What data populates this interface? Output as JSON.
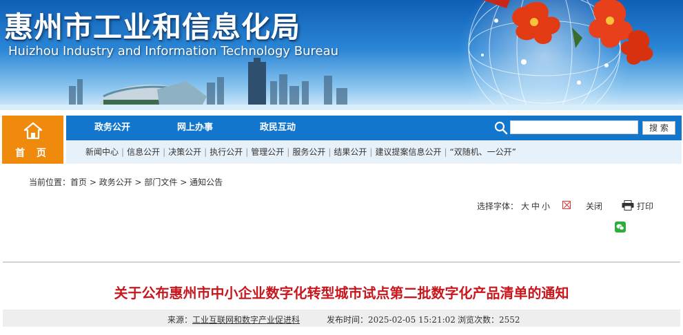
{
  "site": {
    "title": "惠州市工业和信息化局",
    "subtitle": "Huizhou Industry and Information Technology Bureau"
  },
  "nav": {
    "home_label": "首 页",
    "main_items": [
      "政务公开",
      "网上办事",
      "政民互动"
    ],
    "search_placeholder": "",
    "search_button": "搜 索",
    "sub_items": [
      "新闻中心",
      "信息公开",
      "决策公开",
      "执行公开",
      "管理公开",
      "服务公开",
      "结果公开",
      "建议提案信息公开",
      "“双随机、一公开”"
    ]
  },
  "breadcrumb": {
    "label": "当前位置：",
    "items": [
      "首页",
      "政务公开",
      "部门文件",
      "通知公告"
    ],
    "separator": " > "
  },
  "tools": {
    "font_label": "选择字体：",
    "sizes": [
      "大",
      "中",
      "小"
    ],
    "close": "关闭",
    "print": "打印"
  },
  "article": {
    "title": "关于公布惠州市中小企业数字化转型城市试点第二批数字化产品清单的通知",
    "source_label": "来源：",
    "source": "工业互联网和数字产业促进科",
    "published_label": "发布时间：",
    "published": "2025-02-05 15:21:02",
    "views_label": "浏览次数：",
    "views": "2552"
  },
  "colors": {
    "nav_blue": "#1276cc",
    "home_orange": "#f08a0c",
    "subnav_bg": "#e6f1fa",
    "title_red": "#c8161d"
  },
  "icons": {
    "home": "home-icon",
    "search": "search-icon",
    "close": "close-icon",
    "print": "printer-icon",
    "wechat": "wechat-icon"
  }
}
